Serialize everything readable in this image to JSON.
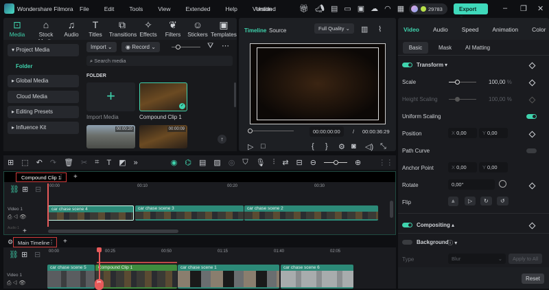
{
  "app": {
    "name": "Wondershare Filmora",
    "project": "Untitled",
    "menu": [
      "File",
      "Edit",
      "Tools",
      "View",
      "Extended",
      "Help",
      "Version"
    ],
    "credits": "29783",
    "export": "Export"
  },
  "colors": {
    "accent": "#3fd3ad",
    "clip": "#2c8a78",
    "compound": "#3f8d3f",
    "playhead": "#e85a5a"
  },
  "toolbar": [
    {
      "label": "Media",
      "icon": "media-icon"
    },
    {
      "label": "Stock Media",
      "icon": "stock-icon"
    },
    {
      "label": "Audio",
      "icon": "audio-icon"
    },
    {
      "label": "Titles",
      "icon": "titles-icon"
    },
    {
      "label": "Transitions",
      "icon": "transitions-icon"
    },
    {
      "label": "Effects",
      "icon": "effects-icon"
    },
    {
      "label": "Filters",
      "icon": "filters-icon"
    },
    {
      "label": "Stickers",
      "icon": "stickers-icon"
    },
    {
      "label": "Templates",
      "icon": "templates-icon"
    }
  ],
  "sidebar": {
    "project_media": "Project Media",
    "folder": "Folder",
    "items": [
      "Global Media",
      "Cloud Media",
      "Editing Presets",
      "Influence Kit"
    ]
  },
  "media": {
    "import": "Import",
    "record": "Record",
    "search_placeholder": "Search media",
    "section": "FOLDER",
    "import_media": "Import Media",
    "compound": "Compound Clip 1",
    "thumb1_duration": "00:00:20",
    "thumb2_duration": "00:00:09"
  },
  "preview": {
    "tabs": [
      "Timeline",
      "Source"
    ],
    "quality": "Full Quality",
    "current": "00:00:00:00",
    "sep": "/",
    "total": "00:00:36:29"
  },
  "props": {
    "tabs": [
      "Video",
      "Audio",
      "Speed",
      "Animation",
      "Color"
    ],
    "subtabs": [
      "Basic",
      "Mask",
      "AI Matting"
    ],
    "transform": "Transform",
    "scale": "Scale",
    "scale_val": "100,00",
    "height_scaling": "Height Scaling",
    "height_val": "100,00",
    "pct": "%",
    "uniform": "Uniform Scaling",
    "position": "Position",
    "x": "X",
    "y": "Y",
    "pos_x": "0,00",
    "pos_y": "0,00",
    "path_curve": "Path Curve",
    "anchor": "Anchor Point",
    "anc_x": "0,00",
    "anc_y": "0,00",
    "rotate": "Rotate",
    "rotate_val": "0,00°",
    "flip": "Flip",
    "compositing": "Compositing",
    "background": "Background",
    "type": "Type",
    "type_val": "Blur",
    "apply_all": "Apply to All",
    "reset": "Reset"
  },
  "compound_tl": {
    "tab": "Compound Clip 1",
    "ticks": [
      "00:00",
      "00:10",
      "00:20",
      "00:30"
    ],
    "track": "Video 1",
    "audio_track": "Audio 1",
    "clips": [
      "car chase scene 4",
      "car chase scene 3",
      "car chase scene 2"
    ]
  },
  "main_tl": {
    "tab": "Main Timeline",
    "ticks": [
      "00:00",
      "00:25",
      "00:50",
      "01:15",
      "01:40",
      "02:05"
    ],
    "track": "Video 1",
    "clips": [
      "car chase scene 5",
      "Compound Clip 1",
      "car chase scene 1",
      "car chase scene 6"
    ]
  }
}
